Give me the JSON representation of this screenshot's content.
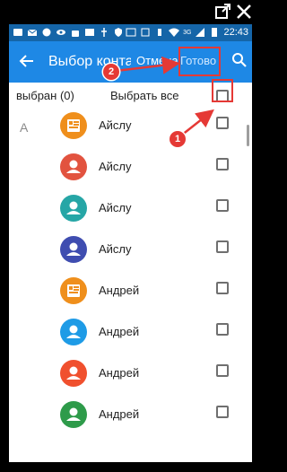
{
  "statusbar": {
    "time": "22:43",
    "network": "3G"
  },
  "appbar": {
    "title": "Выбор контактов",
    "cancel_label": "Отмена",
    "done_label": "Готово"
  },
  "header": {
    "selected_count": "выбран (0)",
    "select_all_label": "Выбрать все"
  },
  "sections": [
    {
      "letter": "A"
    }
  ],
  "contacts": [
    {
      "name": "Айслу",
      "color": "#ef8f1c",
      "icon": "business-card-icon"
    },
    {
      "name": "Айслу",
      "color": "#e2533f",
      "icon": "person-icon"
    },
    {
      "name": "Айслу",
      "color": "#26a6a6",
      "icon": "person-icon"
    },
    {
      "name": "Айслу",
      "color": "#3f4db0",
      "icon": "person-icon"
    },
    {
      "name": "Андрей",
      "color": "#ef8f1c",
      "icon": "business-card-icon"
    },
    {
      "name": "Андрей",
      "color": "#1e9be6",
      "icon": "person-icon"
    },
    {
      "name": "Андрей",
      "color": "#f0502e",
      "icon": "person-icon"
    },
    {
      "name": "Андрей",
      "color": "#2e9b4a",
      "icon": "person-icon"
    }
  ],
  "annotations": [
    {
      "number": "1",
      "target": "select-all-checkbox"
    },
    {
      "number": "2",
      "target": "done-button"
    }
  ],
  "colors": {
    "statusbar": "#1565a8",
    "appbar": "#1e88e5",
    "annotation": "#e53935"
  }
}
